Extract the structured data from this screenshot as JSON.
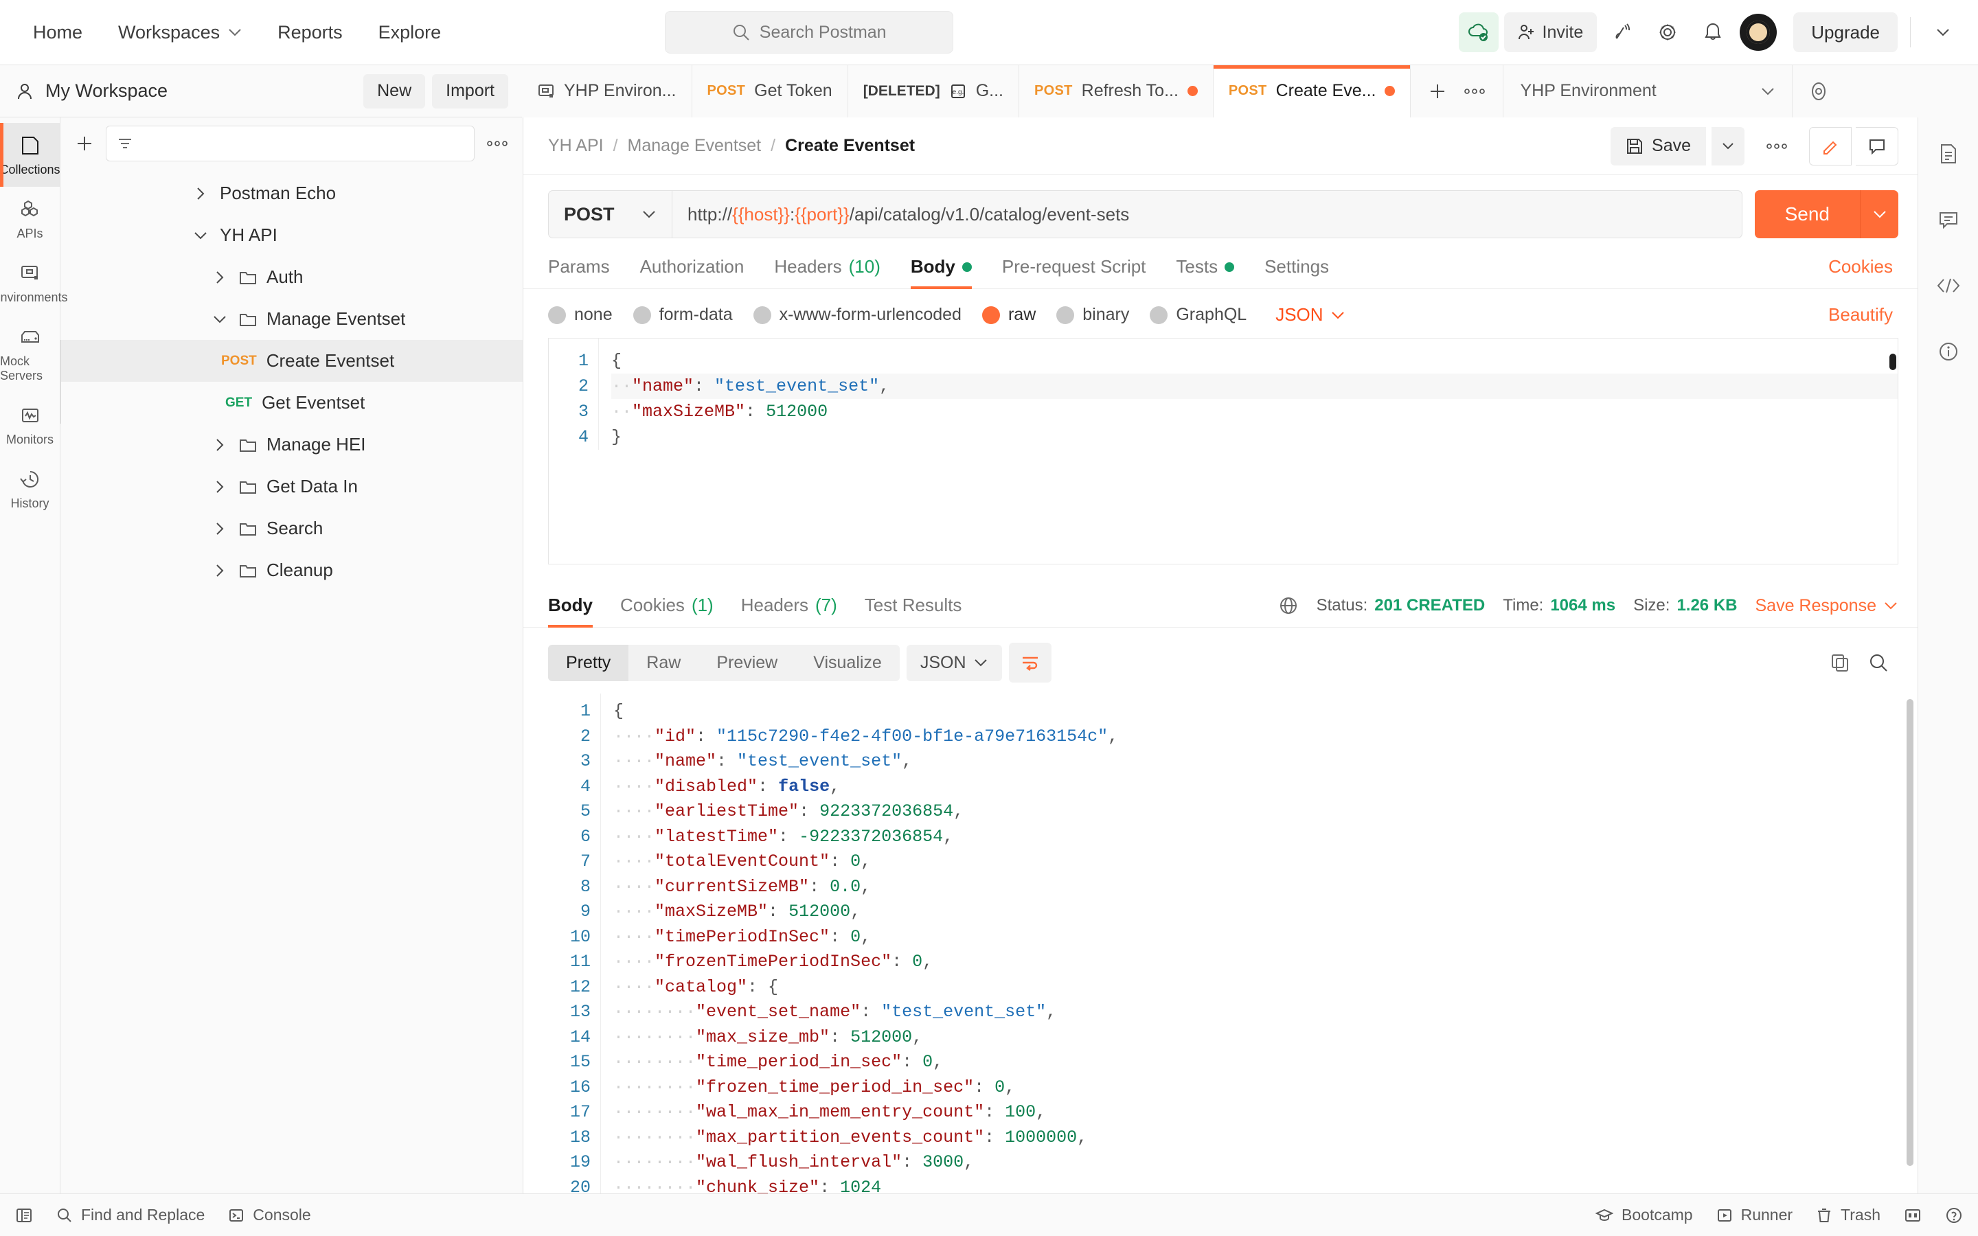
{
  "topnav": {
    "items": [
      {
        "label": "Home",
        "caret": false
      },
      {
        "label": "Workspaces",
        "caret": true
      },
      {
        "label": "Reports",
        "caret": false
      },
      {
        "label": "Explore",
        "caret": false
      }
    ],
    "search_placeholder": "Search Postman",
    "invite_label": "Invite",
    "upgrade_label": "Upgrade",
    "icons": [
      "cloud-check-icon",
      "invite-icon",
      "broadcast-icon",
      "gear-icon",
      "bell-icon",
      "avatar",
      "chevron-down-icon"
    ]
  },
  "workspace": {
    "name": "My Workspace",
    "new_label": "New",
    "import_label": "Import"
  },
  "tabs": [
    {
      "label": "YHP Environ...",
      "method": "",
      "icon": "environment-icon",
      "unsaved": false,
      "active": false
    },
    {
      "label": "Get Token",
      "method": "POST",
      "icon": "",
      "unsaved": false,
      "active": false
    },
    {
      "label": "G...",
      "method": "",
      "prefix": "[DELETED]",
      "icon": "example-icon",
      "unsaved": false,
      "active": false
    },
    {
      "label": "Refresh To...",
      "method": "POST",
      "icon": "",
      "unsaved": true,
      "active": false
    },
    {
      "label": "Create Eve...",
      "method": "POST",
      "icon": "",
      "unsaved": true,
      "active": true
    }
  ],
  "tabbar": {
    "add_label": "+",
    "more_label": "●●●",
    "environment": "YHP Environment"
  },
  "rail": [
    {
      "label": "Collections",
      "icon": "collections-icon",
      "active": true
    },
    {
      "label": "APIs",
      "icon": "apis-icon",
      "active": false
    },
    {
      "label": "Environments",
      "icon": "environments-icon",
      "active": false
    },
    {
      "label": "Mock Servers",
      "icon": "mock-servers-icon",
      "active": false
    },
    {
      "label": "Monitors",
      "icon": "monitors-icon",
      "active": false
    },
    {
      "label": "History",
      "icon": "history-icon",
      "active": false
    }
  ],
  "sidebar": {
    "filter_placeholder": "",
    "tree": [
      {
        "label": "Postman Echo",
        "depth": 0,
        "chevron": "right",
        "type": "collection"
      },
      {
        "label": "YH API",
        "depth": 0,
        "chevron": "down",
        "type": "collection"
      },
      {
        "label": "Auth",
        "depth": 1,
        "chevron": "right",
        "type": "folder"
      },
      {
        "label": "Manage Eventset",
        "depth": 1,
        "chevron": "down",
        "type": "folder"
      },
      {
        "label": "Create Eventset",
        "depth": 2,
        "chevron": "",
        "type": "request",
        "method": "POST",
        "selected": true
      },
      {
        "label": "Get Eventset",
        "depth": 2,
        "chevron": "",
        "type": "request",
        "method": "GET",
        "selected": false
      },
      {
        "label": "Manage HEI",
        "depth": 1,
        "chevron": "right",
        "type": "folder"
      },
      {
        "label": "Get Data In",
        "depth": 1,
        "chevron": "right",
        "type": "folder"
      },
      {
        "label": "Search",
        "depth": 1,
        "chevron": "right",
        "type": "folder"
      },
      {
        "label": "Cleanup",
        "depth": 1,
        "chevron": "right",
        "type": "folder"
      }
    ]
  },
  "breadcrumb": {
    "parts": [
      "YH API",
      "Manage Eventset"
    ],
    "current": "Create Eventset",
    "separator": "/",
    "save_label": "Save"
  },
  "request": {
    "method": "POST",
    "url_scheme": "http://",
    "url_host_var": "{{host}}",
    "url_colon": ":",
    "url_port_var": "{{port}}",
    "url_path": "/api/catalog/v1.0/catalog/event-sets",
    "url_full": "http://{{host}}:{{port}}/api/catalog/v1.0/catalog/event-sets",
    "send_label": "Send",
    "tabs": [
      {
        "label": "Params",
        "active": false
      },
      {
        "label": "Authorization",
        "active": false
      },
      {
        "label": "Headers",
        "count": "(10)",
        "active": false
      },
      {
        "label": "Body",
        "dot": true,
        "active": true
      },
      {
        "label": "Pre-request Script",
        "active": false
      },
      {
        "label": "Tests",
        "dot": true,
        "active": false
      },
      {
        "label": "Settings",
        "active": false
      }
    ],
    "cookies_label": "Cookies",
    "body_types": [
      {
        "label": "none",
        "selected": false
      },
      {
        "label": "form-data",
        "selected": false
      },
      {
        "label": "x-www-form-urlencoded",
        "selected": false
      },
      {
        "label": "raw",
        "selected": true
      },
      {
        "label": "binary",
        "selected": false
      },
      {
        "label": "GraphQL",
        "selected": false
      }
    ],
    "format": "JSON",
    "beautify_label": "Beautify",
    "body_lines": [
      {
        "n": 1,
        "tokens": [
          {
            "t": "{",
            "c": "p"
          }
        ]
      },
      {
        "n": 2,
        "tokens": [
          {
            "t": "··",
            "c": "ind"
          },
          {
            "t": "\"name\"",
            "c": "k"
          },
          {
            "t": ": ",
            "c": "p"
          },
          {
            "t": "\"test_event_set\"",
            "c": "s"
          },
          {
            "t": ",",
            "c": "p"
          }
        ]
      },
      {
        "n": 3,
        "tokens": [
          {
            "t": "··",
            "c": "ind"
          },
          {
            "t": "\"maxSizeMB\"",
            "c": "k"
          },
          {
            "t": ": ",
            "c": "p"
          },
          {
            "t": "512000",
            "c": "n"
          }
        ]
      },
      {
        "n": 4,
        "tokens": [
          {
            "t": "}",
            "c": "p"
          }
        ]
      }
    ]
  },
  "response": {
    "tabs": [
      {
        "label": "Body",
        "active": true
      },
      {
        "label": "Cookies",
        "count": "(1)",
        "active": false
      },
      {
        "label": "Headers",
        "count": "(7)",
        "active": false
      },
      {
        "label": "Test Results",
        "active": false
      }
    ],
    "status_label": "Status:",
    "status_value": "201 CREATED",
    "time_label": "Time:",
    "time_value": "1064 ms",
    "size_label": "Size:",
    "size_value": "1.26 KB",
    "save_response_label": "Save Response",
    "view_modes": [
      {
        "label": "Pretty",
        "active": true
      },
      {
        "label": "Raw",
        "active": false
      },
      {
        "label": "Preview",
        "active": false
      },
      {
        "label": "Visualize",
        "active": false
      }
    ],
    "format": "JSON",
    "body_lines": [
      {
        "n": 1,
        "tokens": [
          {
            "t": "{",
            "c": "p"
          }
        ]
      },
      {
        "n": 2,
        "tokens": [
          {
            "t": "····",
            "c": "ind"
          },
          {
            "t": "\"id\"",
            "c": "k"
          },
          {
            "t": ": ",
            "c": "p"
          },
          {
            "t": "\"115c7290-f4e2-4f00-bf1e-a79e7163154c\"",
            "c": "s"
          },
          {
            "t": ",",
            "c": "p"
          }
        ]
      },
      {
        "n": 3,
        "tokens": [
          {
            "t": "····",
            "c": "ind"
          },
          {
            "t": "\"name\"",
            "c": "k"
          },
          {
            "t": ": ",
            "c": "p"
          },
          {
            "t": "\"test_event_set\"",
            "c": "s"
          },
          {
            "t": ",",
            "c": "p"
          }
        ]
      },
      {
        "n": 4,
        "tokens": [
          {
            "t": "····",
            "c": "ind"
          },
          {
            "t": "\"disabled\"",
            "c": "k"
          },
          {
            "t": ": ",
            "c": "p"
          },
          {
            "t": "false",
            "c": "b"
          },
          {
            "t": ",",
            "c": "p"
          }
        ]
      },
      {
        "n": 5,
        "tokens": [
          {
            "t": "····",
            "c": "ind"
          },
          {
            "t": "\"earliestTime\"",
            "c": "k"
          },
          {
            "t": ": ",
            "c": "p"
          },
          {
            "t": "9223372036854",
            "c": "n"
          },
          {
            "t": ",",
            "c": "p"
          }
        ]
      },
      {
        "n": 6,
        "tokens": [
          {
            "t": "····",
            "c": "ind"
          },
          {
            "t": "\"latestTime\"",
            "c": "k"
          },
          {
            "t": ": ",
            "c": "p"
          },
          {
            "t": "-9223372036854",
            "c": "n"
          },
          {
            "t": ",",
            "c": "p"
          }
        ]
      },
      {
        "n": 7,
        "tokens": [
          {
            "t": "····",
            "c": "ind"
          },
          {
            "t": "\"totalEventCount\"",
            "c": "k"
          },
          {
            "t": ": ",
            "c": "p"
          },
          {
            "t": "0",
            "c": "n"
          },
          {
            "t": ",",
            "c": "p"
          }
        ]
      },
      {
        "n": 8,
        "tokens": [
          {
            "t": "····",
            "c": "ind"
          },
          {
            "t": "\"currentSizeMB\"",
            "c": "k"
          },
          {
            "t": ": ",
            "c": "p"
          },
          {
            "t": "0.0",
            "c": "n"
          },
          {
            "t": ",",
            "c": "p"
          }
        ]
      },
      {
        "n": 9,
        "tokens": [
          {
            "t": "····",
            "c": "ind"
          },
          {
            "t": "\"maxSizeMB\"",
            "c": "k"
          },
          {
            "t": ": ",
            "c": "p"
          },
          {
            "t": "512000",
            "c": "n"
          },
          {
            "t": ",",
            "c": "p"
          }
        ]
      },
      {
        "n": 10,
        "tokens": [
          {
            "t": "····",
            "c": "ind"
          },
          {
            "t": "\"timePeriodInSec\"",
            "c": "k"
          },
          {
            "t": ": ",
            "c": "p"
          },
          {
            "t": "0",
            "c": "n"
          },
          {
            "t": ",",
            "c": "p"
          }
        ]
      },
      {
        "n": 11,
        "tokens": [
          {
            "t": "····",
            "c": "ind"
          },
          {
            "t": "\"frozenTimePeriodInSec\"",
            "c": "k"
          },
          {
            "t": ": ",
            "c": "p"
          },
          {
            "t": "0",
            "c": "n"
          },
          {
            "t": ",",
            "c": "p"
          }
        ]
      },
      {
        "n": 12,
        "tokens": [
          {
            "t": "····",
            "c": "ind"
          },
          {
            "t": "\"catalog\"",
            "c": "k"
          },
          {
            "t": ": {",
            "c": "p"
          }
        ]
      },
      {
        "n": 13,
        "tokens": [
          {
            "t": "········",
            "c": "ind"
          },
          {
            "t": "\"event_set_name\"",
            "c": "k"
          },
          {
            "t": ": ",
            "c": "p"
          },
          {
            "t": "\"test_event_set\"",
            "c": "s"
          },
          {
            "t": ",",
            "c": "p"
          }
        ]
      },
      {
        "n": 14,
        "tokens": [
          {
            "t": "········",
            "c": "ind"
          },
          {
            "t": "\"max_size_mb\"",
            "c": "k"
          },
          {
            "t": ": ",
            "c": "p"
          },
          {
            "t": "512000",
            "c": "n"
          },
          {
            "t": ",",
            "c": "p"
          }
        ]
      },
      {
        "n": 15,
        "tokens": [
          {
            "t": "········",
            "c": "ind"
          },
          {
            "t": "\"time_period_in_sec\"",
            "c": "k"
          },
          {
            "t": ": ",
            "c": "p"
          },
          {
            "t": "0",
            "c": "n"
          },
          {
            "t": ",",
            "c": "p"
          }
        ]
      },
      {
        "n": 16,
        "tokens": [
          {
            "t": "········",
            "c": "ind"
          },
          {
            "t": "\"frozen_time_period_in_sec\"",
            "c": "k"
          },
          {
            "t": ": ",
            "c": "p"
          },
          {
            "t": "0",
            "c": "n"
          },
          {
            "t": ",",
            "c": "p"
          }
        ]
      },
      {
        "n": 17,
        "tokens": [
          {
            "t": "········",
            "c": "ind"
          },
          {
            "t": "\"wal_max_in_mem_entry_count\"",
            "c": "k"
          },
          {
            "t": ": ",
            "c": "p"
          },
          {
            "t": "100",
            "c": "n"
          },
          {
            "t": ",",
            "c": "p"
          }
        ]
      },
      {
        "n": 18,
        "tokens": [
          {
            "t": "········",
            "c": "ind"
          },
          {
            "t": "\"max_partition_events_count\"",
            "c": "k"
          },
          {
            "t": ": ",
            "c": "p"
          },
          {
            "t": "1000000",
            "c": "n"
          },
          {
            "t": ",",
            "c": "p"
          }
        ]
      },
      {
        "n": 19,
        "tokens": [
          {
            "t": "········",
            "c": "ind"
          },
          {
            "t": "\"wal_flush_interval\"",
            "c": "k"
          },
          {
            "t": ": ",
            "c": "p"
          },
          {
            "t": "3000",
            "c": "n"
          },
          {
            "t": ",",
            "c": "p"
          }
        ]
      },
      {
        "n": 20,
        "tokens": [
          {
            "t": "········",
            "c": "ind"
          },
          {
            "t": "\"chunk_size\"",
            "c": "k"
          },
          {
            "t": ": ",
            "c": "p"
          },
          {
            "t": "1024",
            "c": "n"
          }
        ]
      }
    ]
  },
  "statusbar": {
    "left": [
      {
        "label": "",
        "icon": "sidebar-toggle-icon"
      },
      {
        "label": "Find and Replace",
        "icon": "search-icon"
      },
      {
        "label": "Console",
        "icon": "console-icon"
      }
    ],
    "right": [
      {
        "label": "Bootcamp",
        "icon": "bootcamp-icon"
      },
      {
        "label": "Runner",
        "icon": "runner-icon"
      },
      {
        "label": "Trash",
        "icon": "trash-icon"
      },
      {
        "label": "",
        "icon": "layout-icon"
      },
      {
        "label": "",
        "icon": "help-icon"
      }
    ]
  },
  "right_rail": [
    {
      "icon": "documentation-icon"
    },
    {
      "icon": "comment-icon"
    },
    {
      "icon": "code-icon"
    },
    {
      "icon": "info-icon"
    }
  ]
}
